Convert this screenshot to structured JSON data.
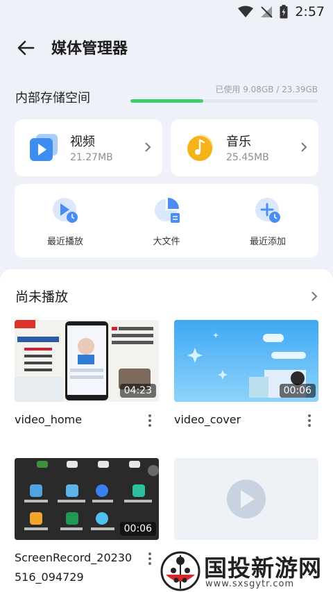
{
  "status": {
    "time": "2:57"
  },
  "header": {
    "title": "媒体管理器"
  },
  "storage": {
    "label": "内部存储空间",
    "used_text": "已使用 9.08GB / 23.39GB",
    "used_fraction": 0.388
  },
  "categories": [
    {
      "name": "视频",
      "size": "21.27MB",
      "icon": "video-icon"
    },
    {
      "name": "音乐",
      "size": "25.45MB",
      "icon": "music-icon"
    }
  ],
  "quick_actions": [
    {
      "label": "最近播放",
      "icon": "recent-play-icon"
    },
    {
      "label": "大文件",
      "icon": "large-file-icon"
    },
    {
      "label": "最近添加",
      "icon": "recent-add-icon"
    }
  ],
  "section": {
    "title": "尚未播放"
  },
  "videos": [
    {
      "name": "video_home",
      "duration": "04:23"
    },
    {
      "name": "video_cover",
      "duration": "00:06"
    },
    {
      "name": "ScreenRecord_20230516_094729",
      "duration": "00:06"
    },
    {
      "name": "",
      "duration": ""
    }
  ],
  "watermark": {
    "text": "国投新游网",
    "url": "www.sxsgytr.com"
  },
  "colors": {
    "progress": "#3bcf6a",
    "video_icon": "#3d8ef0",
    "music_icon": "#f6b319",
    "accent_icon": "#4a8ef5"
  }
}
